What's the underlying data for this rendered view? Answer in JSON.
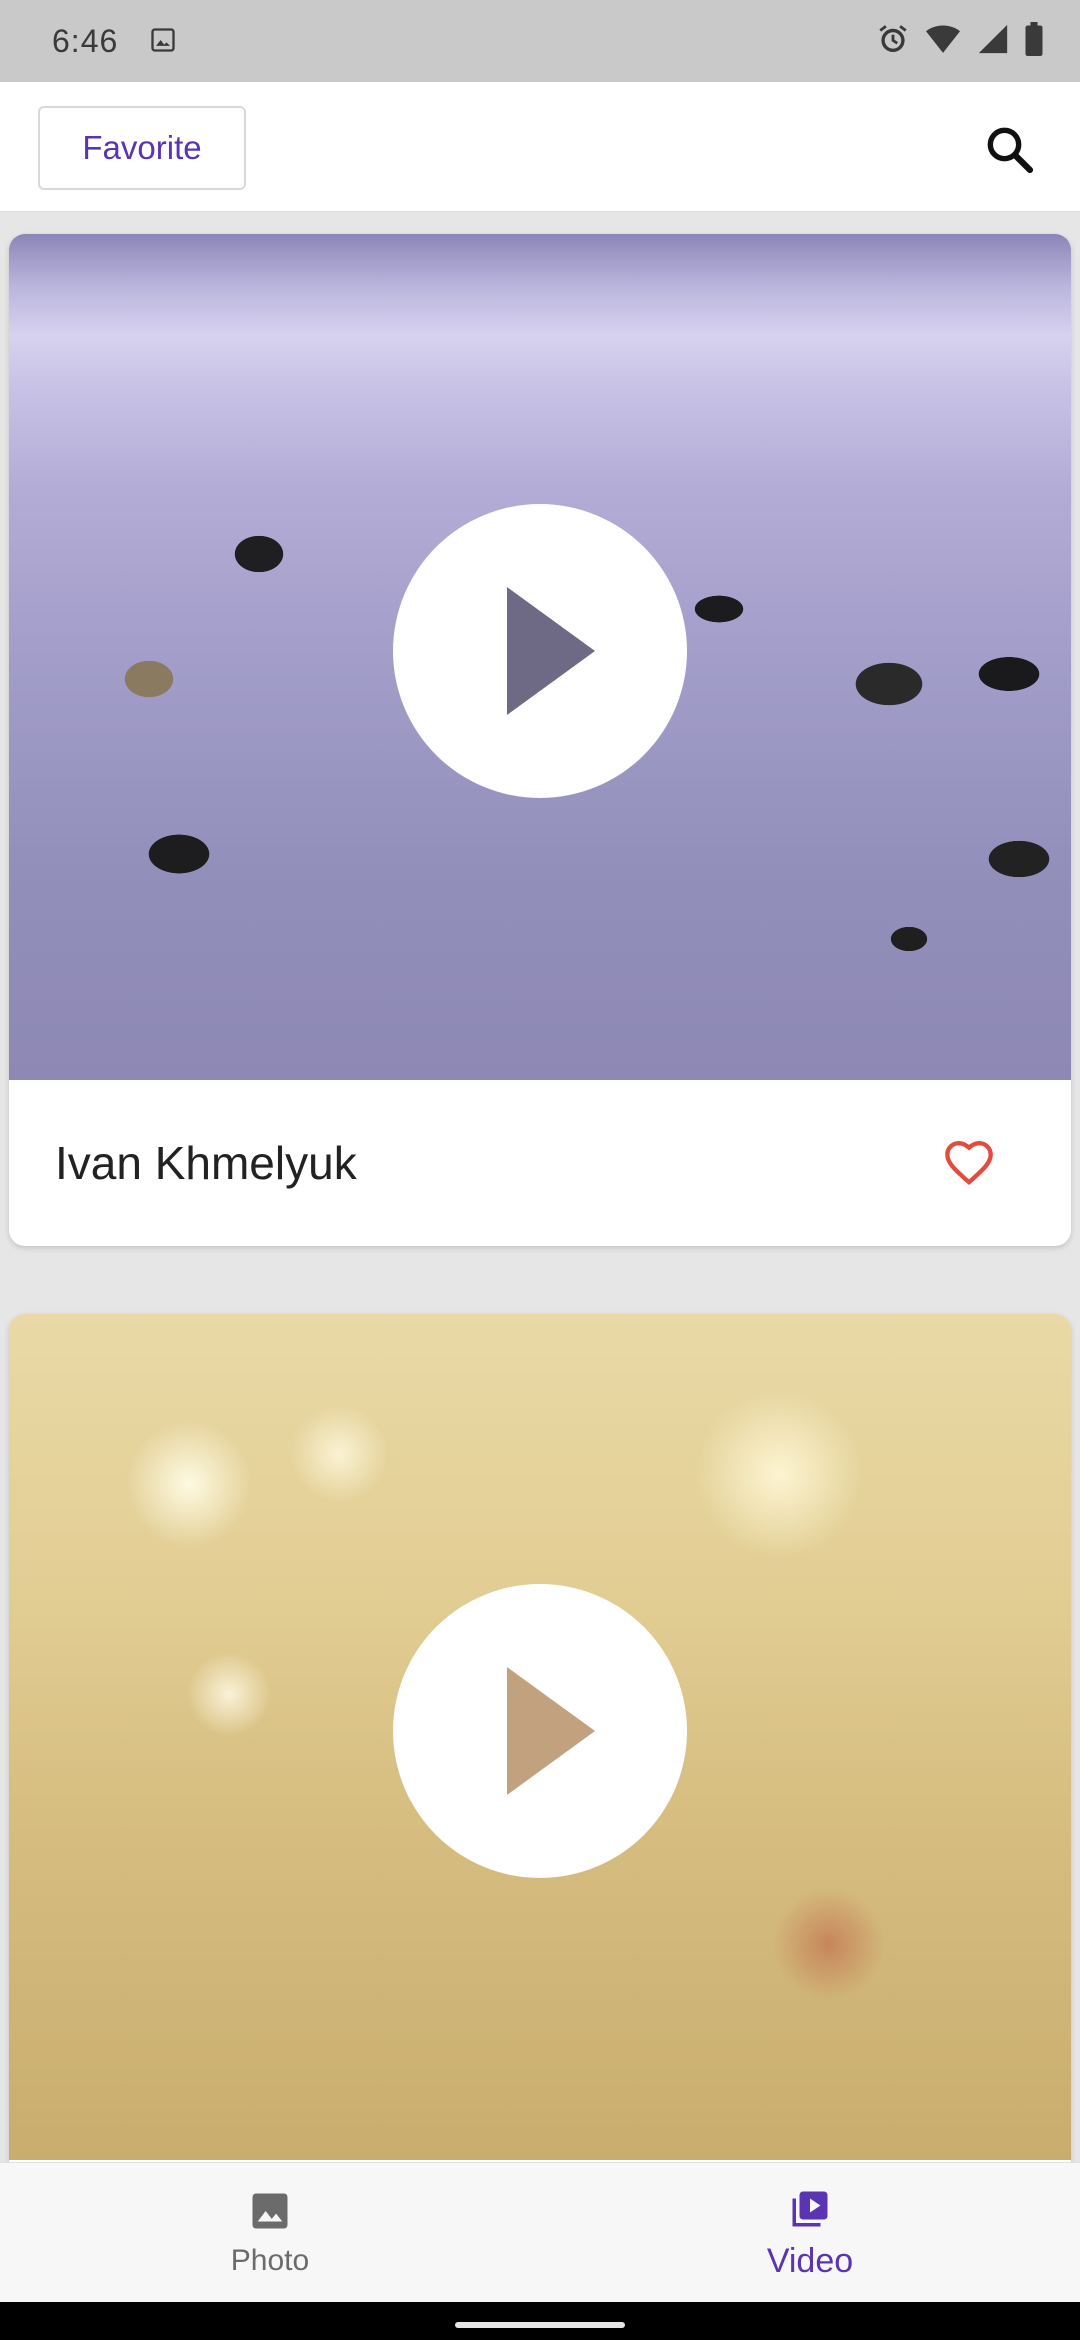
{
  "status_bar": {
    "time": "6:46",
    "icons": [
      "gallery-icon",
      "alarm-icon",
      "wifi-icon",
      "signal-icon",
      "battery-icon"
    ]
  },
  "app_bar": {
    "favorite_label": "Favorite",
    "search_icon": "search-icon"
  },
  "feed": {
    "items": [
      {
        "author": "Ivan Khmelyuk",
        "play_icon": "play-icon",
        "favorite_icon": "heart-outline-icon"
      },
      {
        "author": "",
        "play_icon": "play-icon"
      }
    ]
  },
  "bottom_nav": {
    "items": [
      {
        "label": "Photo",
        "icon": "photo-icon",
        "selected": false
      },
      {
        "label": "Video",
        "icon": "video-library-icon",
        "selected": true
      }
    ]
  },
  "colors": {
    "accent": "#5b35b1",
    "heart": "#e34b3d",
    "status_bar_bg": "#c9c9c9",
    "nav_inactive": "#6b6b6b"
  }
}
